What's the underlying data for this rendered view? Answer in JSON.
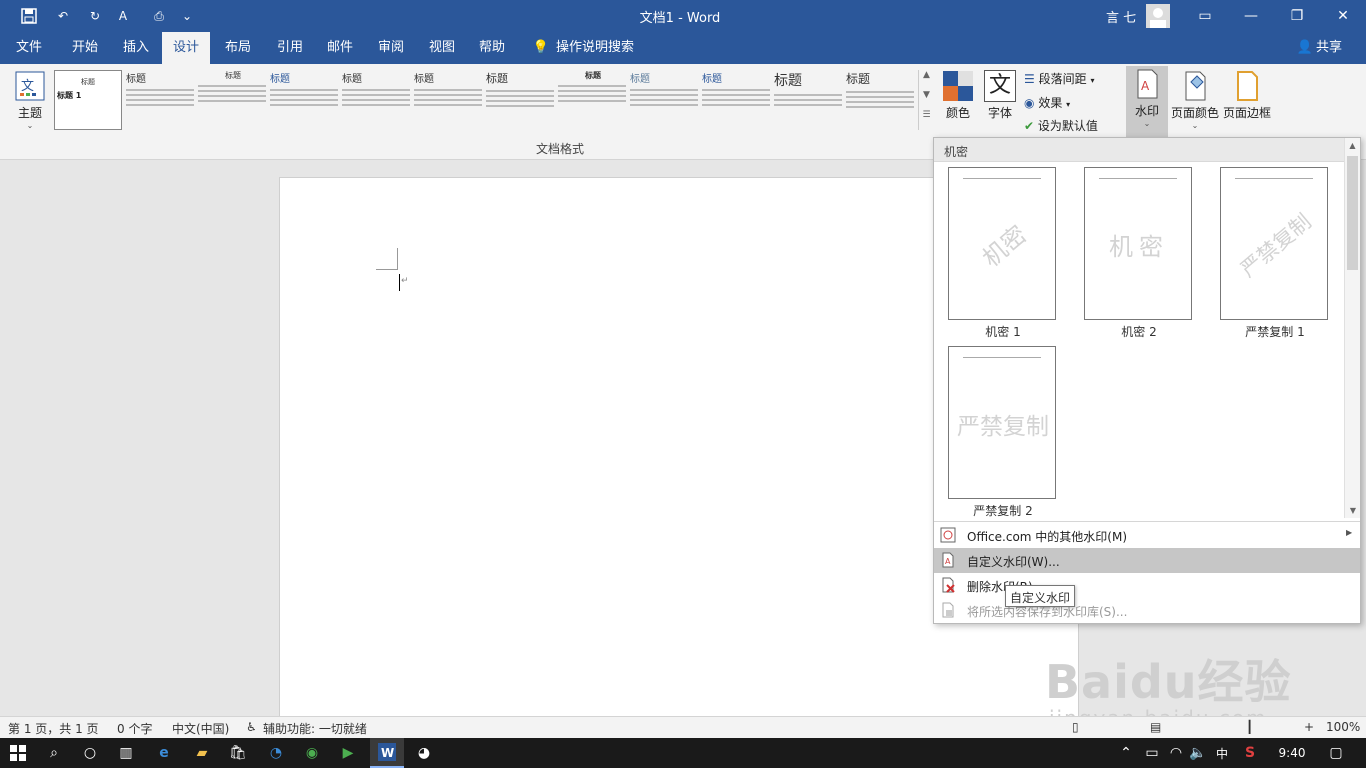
{
  "window": {
    "title": "文档1 - Word",
    "user": "言 七"
  },
  "tabs": [
    {
      "label": "文件"
    },
    {
      "label": "开始"
    },
    {
      "label": "插入"
    },
    {
      "label": "设计"
    },
    {
      "label": "布局"
    },
    {
      "label": "引用"
    },
    {
      "label": "邮件"
    },
    {
      "label": "审阅"
    },
    {
      "label": "视图"
    },
    {
      "label": "帮助"
    }
  ],
  "tell_me": "操作说明搜索",
  "share": "共享",
  "ribbon": {
    "theme_label": "主题",
    "group_label": "文档格式",
    "colors_label": "颜色",
    "fonts_label": "字体",
    "paragraph_spacing": "段落间距",
    "effects": "效果",
    "set_default": "设为默认值",
    "watermark": "水印",
    "page_color": "页面颜色",
    "page_border": "页面边框",
    "style_titles": [
      "标题",
      "标题",
      "标题",
      "标题",
      "标题",
      "标题",
      "标题",
      "标题",
      "标题",
      "标题",
      "标题",
      "标题"
    ],
    "first_thumb_heading": "标题 1"
  },
  "watermark_panel": {
    "section": "机密",
    "items": [
      {
        "text": "机密",
        "label": "机密 1",
        "style": "diagonal"
      },
      {
        "text": "机密",
        "label": "机密 2",
        "style": "horizontal"
      },
      {
        "text": "严禁复制",
        "label": "严禁复制 1",
        "style": "diagonal"
      },
      {
        "text": "严禁复制",
        "label": "严禁复制 2",
        "style": "horizontal"
      }
    ],
    "menu": [
      {
        "label": "Office.com 中的其他水印(M)",
        "state": "normal"
      },
      {
        "label": "自定义水印(W)...",
        "state": "highlighted"
      },
      {
        "label": "删除水印(R)",
        "state": "normal"
      },
      {
        "label": "将所选内容保存到水印库(S)...",
        "state": "disabled"
      }
    ],
    "tooltip": "自定义水印"
  },
  "status": {
    "page": "第 1 页，共 1 页",
    "words": "0 个字",
    "language": "中文(中国)",
    "accessibility": "辅助功能: 一切就绪",
    "zoom": "100%"
  },
  "taskbar": {
    "time": "9:40",
    "ime": "中"
  },
  "overlay_watermark": {
    "brand": "Baidu经验",
    "url": "jingyan.baidu.com"
  }
}
